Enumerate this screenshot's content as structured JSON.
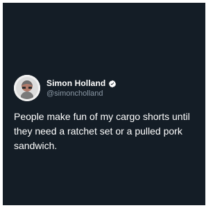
{
  "colors": {
    "background": "#141d26",
    "name_text": "#ffffff",
    "handle_text": "#8b98a5",
    "tweet_text": "#ffffff",
    "verified_badge": "#ffffff"
  },
  "author": {
    "name": "Simon Holland",
    "handle": "@simoncholland",
    "verified_icon": "verified-badge-icon",
    "avatar_icon": "avatar-photo"
  },
  "tweet": {
    "text": "People make fun of my cargo shorts until they need a ratchet set or a pulled pork sandwich."
  }
}
